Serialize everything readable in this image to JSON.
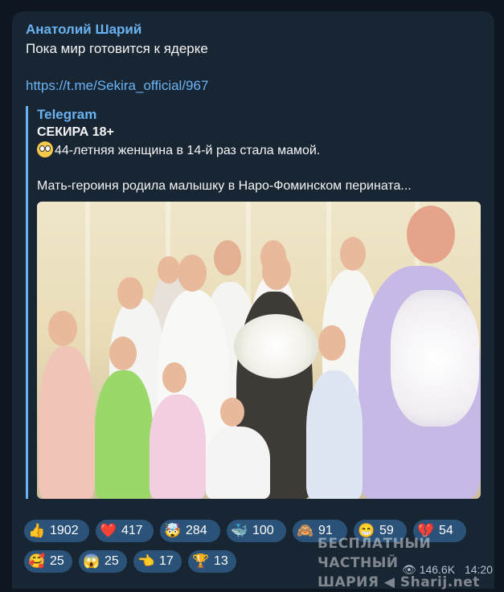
{
  "post": {
    "author": "Анатолий Шарий",
    "text": "Пока мир готовится к ядерке",
    "link": "https://t.me/Sekira_official/967"
  },
  "forward": {
    "source": "Telegram",
    "channel": "СЕКИРА 18+",
    "line1": "44-летняя женщина в 14-й раз стала мамой.",
    "line1_emoji": "flushed-face-icon",
    "line2": "Мать-героиня родила малышку в Наро-Фоминском перината..."
  },
  "reactions": [
    {
      "icon": "thumbs-up-icon",
      "glyph": "👍",
      "count": "1902"
    },
    {
      "icon": "red-heart-icon",
      "glyph": "❤️",
      "count": "417"
    },
    {
      "icon": "exploding-head-icon",
      "glyph": "🤯",
      "count": "284"
    },
    {
      "icon": "whale-icon",
      "glyph": "🐳",
      "count": "100"
    },
    {
      "icon": "see-no-evil-monkey-icon",
      "glyph": "🙈",
      "count": "91"
    },
    {
      "icon": "grinning-face-icon",
      "glyph": "😁",
      "count": "59"
    },
    {
      "icon": "broken-heart-icon",
      "glyph": "💔",
      "count": "54"
    },
    {
      "icon": "smiling-face-hearts-icon",
      "glyph": "🥰",
      "count": "25"
    },
    {
      "icon": "screaming-face-icon",
      "glyph": "😱",
      "count": "25"
    },
    {
      "icon": "pointing-hand-icon",
      "glyph": "👈",
      "count": "17"
    },
    {
      "icon": "trophy-icon",
      "glyph": "🏆",
      "count": "13"
    }
  ],
  "meta": {
    "views": "146.6K",
    "time": "14:20"
  },
  "watermark": {
    "line1": "БЕСПЛАТНЫЙ ЧАСТНЫЙ",
    "line2": "ШАРИЯ ◀ Sharij.net"
  },
  "colors": {
    "bg": "#0e1621",
    "bubble": "#182533",
    "accent": "#6ab3f3",
    "reaction": "#2b5278"
  }
}
